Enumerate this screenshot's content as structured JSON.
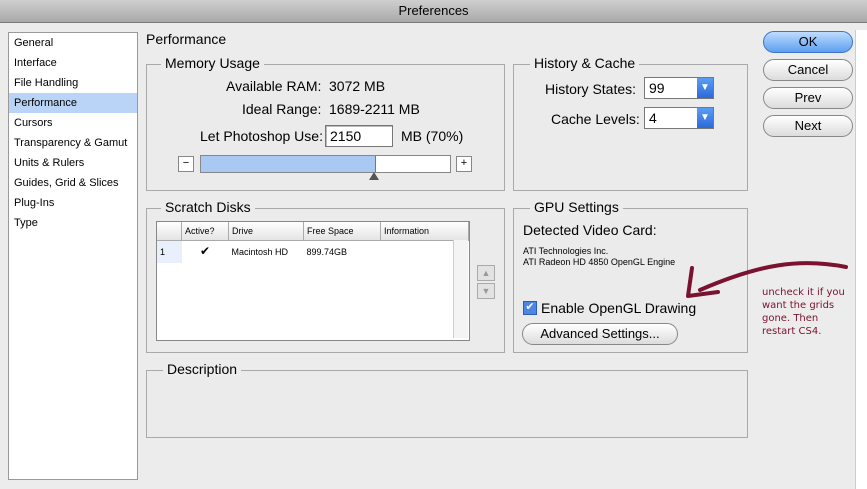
{
  "window": {
    "title": "Preferences"
  },
  "sidebar": {
    "items": [
      {
        "label": "General"
      },
      {
        "label": "Interface"
      },
      {
        "label": "File Handling"
      },
      {
        "label": "Performance"
      },
      {
        "label": "Cursors"
      },
      {
        "label": "Transparency & Gamut"
      },
      {
        "label": "Units & Rulers"
      },
      {
        "label": "Guides, Grid & Slices"
      },
      {
        "label": "Plug-Ins"
      },
      {
        "label": "Type"
      }
    ],
    "selected": "Performance"
  },
  "section_title": "Performance",
  "memory": {
    "title": "Memory Usage",
    "available_label": "Available RAM:",
    "available_value": "3072 MB",
    "ideal_label": "Ideal Range:",
    "ideal_value": "1689-2211 MB",
    "use_label": "Let Photoshop Use:",
    "use_value": "2150",
    "use_unit": "MB (70%)",
    "minus": "−",
    "plus": "+",
    "slider_fraction": 0.7
  },
  "history": {
    "title": "History & Cache",
    "states_label": "History States:",
    "states_value": "99",
    "cache_label": "Cache Levels:",
    "cache_value": "4",
    "dropdown_arrow": "▼"
  },
  "scratch": {
    "title": "Scratch Disks",
    "columns": [
      "",
      "Active?",
      "Drive",
      "Free Space",
      "Information"
    ],
    "rows": [
      {
        "num": "1",
        "active": "✔",
        "drive": "Macintosh HD",
        "free": "899.74GB",
        "info": ""
      }
    ],
    "up": "▲",
    "down": "▼"
  },
  "gpu": {
    "title": "GPU Settings",
    "detected_label": "Detected Video Card:",
    "card_line1": "ATI Technologies Inc.",
    "card_line2": "ATI Radeon HD 4850 OpenGL Engine",
    "enable_label": "Enable OpenGL Drawing",
    "enable_checked": "✔",
    "advanced_label": "Advanced Settings..."
  },
  "description": {
    "title": "Description"
  },
  "buttons": {
    "ok": "OK",
    "cancel": "Cancel",
    "prev": "Prev",
    "next": "Next"
  },
  "annotation": {
    "text": "uncheck it if you want the grids gone. Then restart CS4.",
    "color": "#7a1230"
  }
}
